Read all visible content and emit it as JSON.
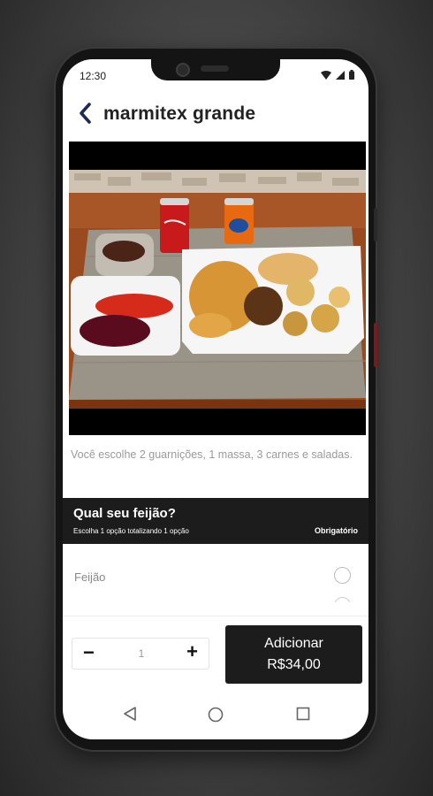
{
  "status": {
    "time": "12:30"
  },
  "header": {
    "title": "marmitex grande"
  },
  "product": {
    "description": "Você escolhe 2 guarnições, 1 massa, 3 carnes e saladas."
  },
  "section": {
    "title": "Qual seu feijão?",
    "subtitle": "Escolha 1 opção totalizando 1 opção",
    "badge": "Obrigatório"
  },
  "options": [
    {
      "label": "Feijão"
    }
  ],
  "order": {
    "minus_label": "−",
    "quantity": "1",
    "plus_label": "+",
    "add_label": "Adicionar",
    "price": "R$34,00"
  },
  "icons": {
    "back": "chevron-left-icon",
    "wifi": "wifi-icon",
    "signal": "signal-icon",
    "battery": "battery-icon",
    "nav_back": "triangle-back-icon",
    "nav_home": "circle-home-icon",
    "nav_recents": "square-recents-icon"
  },
  "colors": {
    "accent": "#1c1c1c",
    "title_dark": "#1e2a55",
    "muted_text": "#9a9a9a"
  }
}
